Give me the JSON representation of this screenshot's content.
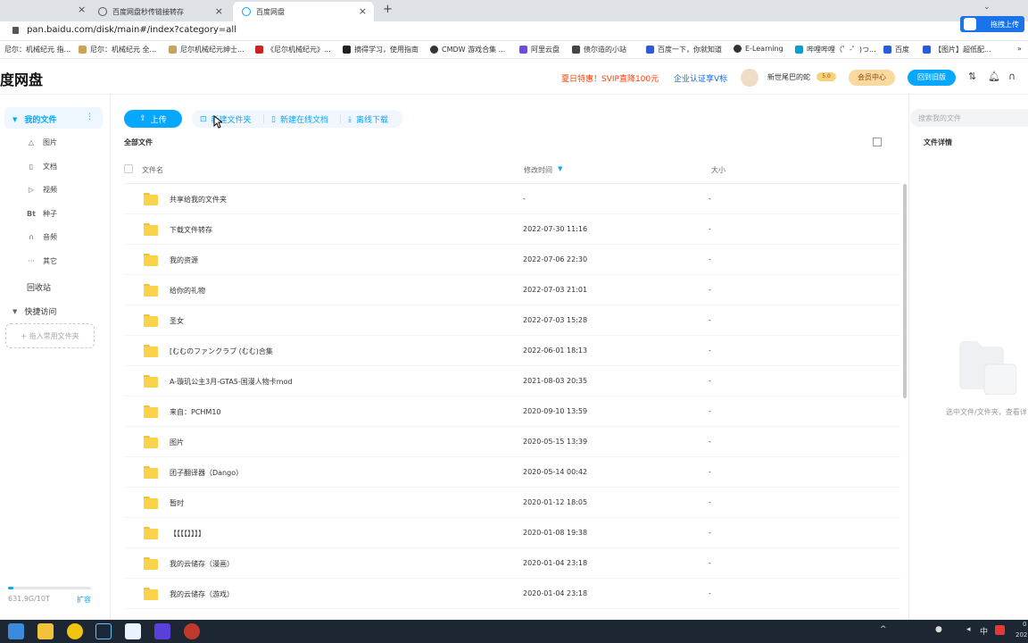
{
  "browser": {
    "tabs": [
      {
        "label": "百度网盘秒传链接转存"
      },
      {
        "label": "百度网盘"
      }
    ],
    "new_tab_icon": "plus-icon",
    "url": "pan.baidu.com/disk/main#/index?category=all",
    "bookmarks": [
      "尼尔：机械纪元 指...",
      "尼尔：机械纪元 全...",
      "尼尔机械纪元绅士...",
      "《尼尔机械纪元》...",
      "摘得学习，使用指南",
      "CMDW 游戏合集 ...",
      "阿里云盘",
      "债尔造的小站",
      "百度一下，你就知道",
      "E-Learning",
      "哔哩哔哩（゜-゜)つ...",
      "百度",
      "【图片】超低配..."
    ],
    "floating_label": "拖拽上传"
  },
  "header": {
    "logo": "度网盘",
    "promo": "夏日特惠！SVIP直降100元",
    "cert": "企业认证享V标",
    "username": "新世尾巴的蛇",
    "badge": "5.0",
    "vip_center": "会员中心",
    "old_version": "回到旧版"
  },
  "sidebar": {
    "my_files": "我的文件",
    "items": [
      {
        "label": "图片",
        "icon": "image-icon"
      },
      {
        "label": "文档",
        "icon": "document-icon"
      },
      {
        "label": "视频",
        "icon": "video-icon"
      },
      {
        "label": "种子",
        "icon": "torrent-icon"
      },
      {
        "label": "音频",
        "icon": "audio-icon"
      },
      {
        "label": "其它",
        "icon": "more-icon"
      }
    ],
    "recycle": "回收站",
    "quick_access": "快捷访问",
    "drop_zone": "+ 拖入常用文件夹",
    "storage": "631.9G/10T",
    "storage_used_fraction": 0.06,
    "expand": "扩容"
  },
  "toolbar": {
    "upload": "上传",
    "new_folder": "新建文件夹",
    "new_doc": "新建在线文档",
    "offline": "离线下载"
  },
  "breadcrumb": "全部文件",
  "table": {
    "headers": {
      "name": "文件名",
      "modified": "修改时间",
      "size": "大小"
    },
    "rows": [
      {
        "name": "共享给我的文件夹",
        "date": "-",
        "size": "-"
      },
      {
        "name": "下载文件转存",
        "date": "2022-07-30 11:16",
        "size": "-"
      },
      {
        "name": "我的资源",
        "date": "2022-07-06 22:30",
        "size": "-"
      },
      {
        "name": "给你的礼物",
        "date": "2022-07-03 21:01",
        "size": "-"
      },
      {
        "name": "圣女",
        "date": "2022-07-03 15:28",
        "size": "-"
      },
      {
        "name": "[むむのファンクラブ (むむ)合集",
        "date": "2022-06-01 18:13",
        "size": "-"
      },
      {
        "name": "A-璇玑公主3月-GTA5-国漫人物卡mod",
        "date": "2021-08-03 20:35",
        "size": "-"
      },
      {
        "name": "来自：PCHM10",
        "date": "2020-09-10 13:59",
        "size": "-"
      },
      {
        "name": "图片",
        "date": "2020-05-15 13:39",
        "size": "-"
      },
      {
        "name": "团子翻译器（Dango）",
        "date": "2020-05-14 00:42",
        "size": "-"
      },
      {
        "name": "暂时",
        "date": "2020-01-12 18:05",
        "size": "-"
      },
      {
        "name": "【【【【】】】】",
        "date": "2020-01-08 19:38",
        "size": "-"
      },
      {
        "name": "我的云储存（漫画）",
        "date": "2020-01-04 23:18",
        "size": "-"
      },
      {
        "name": "我的云储存（游戏）",
        "date": "2020-01-04 23:18",
        "size": "-"
      }
    ]
  },
  "right_panel": {
    "search_placeholder": "搜索我的文件",
    "detail_title": "文件详情",
    "empty_text": "选中文件/文件夹，查看详"
  },
  "taskbar": {
    "lang": "中",
    "time": "0",
    "date": "202"
  },
  "colors": {
    "accent": "#06a7ff",
    "promo": "#ff3c00",
    "folder": "#fbd24b"
  }
}
